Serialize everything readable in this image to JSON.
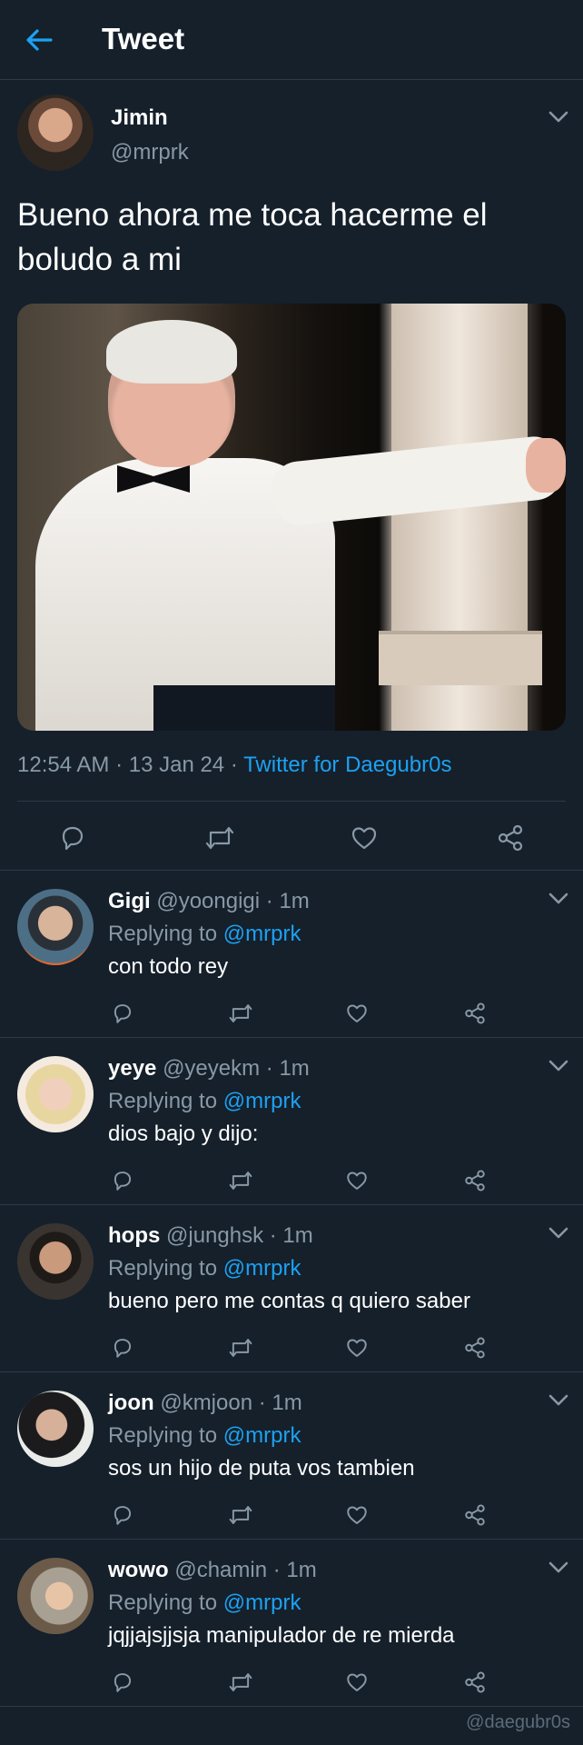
{
  "colors": {
    "background": "#15202b",
    "accent": "#1da1f2",
    "secondary_text": "#8899a6",
    "divider": "#2b3a48"
  },
  "header": {
    "back_icon": "arrow-left-icon",
    "title": "Tweet"
  },
  "main_tweet": {
    "name": "Jimin",
    "handle": "@mrprk",
    "text": "Bueno ahora me toca hacerme el boludo a mi",
    "time": "12:54 AM",
    "sep1": " · ",
    "date": "13 Jan 24",
    "sep2": " · ",
    "source": "Twitter for Daegubr0s",
    "actions": [
      "reply-icon",
      "retweet-icon",
      "like-icon",
      "share-icon"
    ]
  },
  "replies": [
    {
      "name": "Gigi",
      "handle": "@yoongigi",
      "time": "· 1m",
      "replying_prefix": "Replying to ",
      "replying_to": "@mrprk",
      "text": "con todo rey"
    },
    {
      "name": "yeye",
      "handle": "@yeyekm",
      "time": "· 1m",
      "replying_prefix": "Replying to ",
      "replying_to": "@mrprk",
      "text": "dios bajo y dijo:"
    },
    {
      "name": "hops",
      "handle": "@junghsk",
      "time": "· 1m",
      "replying_prefix": "Replying to ",
      "replying_to": "@mrprk",
      "text": "bueno pero me contas q quiero saber"
    },
    {
      "name": "joon",
      "handle": "@kmjoon",
      "time": "· 1m",
      "replying_prefix": "Replying to ",
      "replying_to": "@mrprk",
      "text": "sos un hijo de puta vos tambien"
    },
    {
      "name": "wowo",
      "handle": "@chamin",
      "time": "· 1m",
      "replying_prefix": "Replying to ",
      "replying_to": "@mrprk",
      "text": "jqjjajsjjsja manipulador de re mierda"
    }
  ],
  "watermark": "@daegubr0s"
}
